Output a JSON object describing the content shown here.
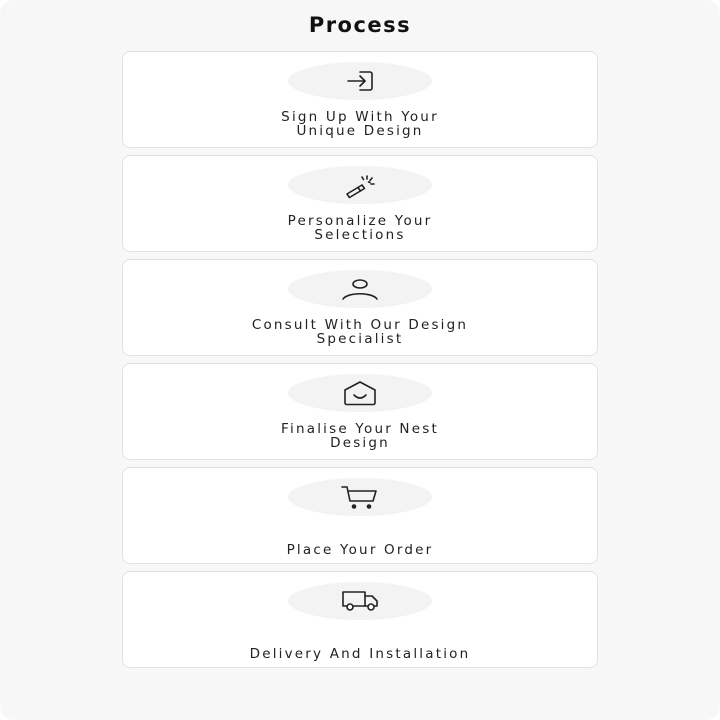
{
  "title": "Process",
  "steps": [
    {
      "line1": "Sign Up With Your",
      "line2": "Unique Design",
      "icon": "sign-in-icon"
    },
    {
      "line1": "Personalize Your",
      "line2": "Selections",
      "icon": "magic-wand-icon"
    },
    {
      "line1": "Consult With Our Design",
      "line2": "Specialist",
      "icon": "user-icon"
    },
    {
      "line1": "Finalise Your Nest",
      "line2": "Design",
      "icon": "home-smile-icon"
    },
    {
      "line1": "Place Your Order",
      "line2": "",
      "icon": "shopping-cart-icon"
    },
    {
      "line1": "Delivery And Installation",
      "line2": "",
      "icon": "truck-icon"
    }
  ],
  "colors": {
    "page_background": "#f7f7f7",
    "card_background": "#ffffff",
    "card_border": "#e2e2e2",
    "icon_circle": "#f3f3f3",
    "text": "#222222"
  }
}
